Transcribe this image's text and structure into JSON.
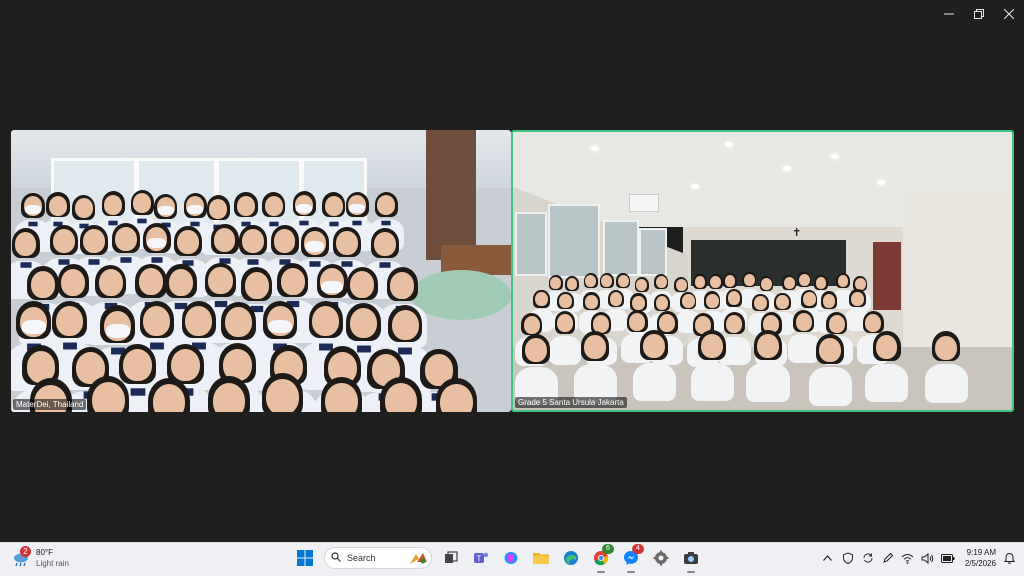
{
  "window": {
    "minimize_icon": "minimize-icon",
    "restore_icon": "restore-icon",
    "close_icon": "close-icon"
  },
  "tiles": [
    {
      "label": "MaterDei, Thailand",
      "active": false
    },
    {
      "label": "Grade 5 Santa Ursula Jakarta",
      "active": true,
      "border_color": "#3ec583"
    }
  ],
  "taskbar": {
    "weather": {
      "alert_count": "2",
      "temperature": "80°F",
      "description": "Light rain"
    },
    "search": {
      "label": "Search"
    },
    "apps": [
      {
        "name": "windows-start-icon"
      },
      {
        "name": "search"
      },
      {
        "name": "task-view-icon"
      },
      {
        "name": "teams-icon"
      },
      {
        "name": "copilot-icon"
      },
      {
        "name": "file-explorer-icon"
      },
      {
        "name": "edge-icon"
      },
      {
        "name": "chrome-icon",
        "badge": "6"
      },
      {
        "name": "messenger-icon",
        "badge": "4"
      },
      {
        "name": "settings-icon"
      },
      {
        "name": "camera-icon"
      }
    ],
    "tray": {
      "clock_time": "9:19 AM",
      "clock_date": "2/5/2026"
    },
    "colors": {
      "accent": "#0078d4",
      "badge": "#d13438"
    }
  }
}
